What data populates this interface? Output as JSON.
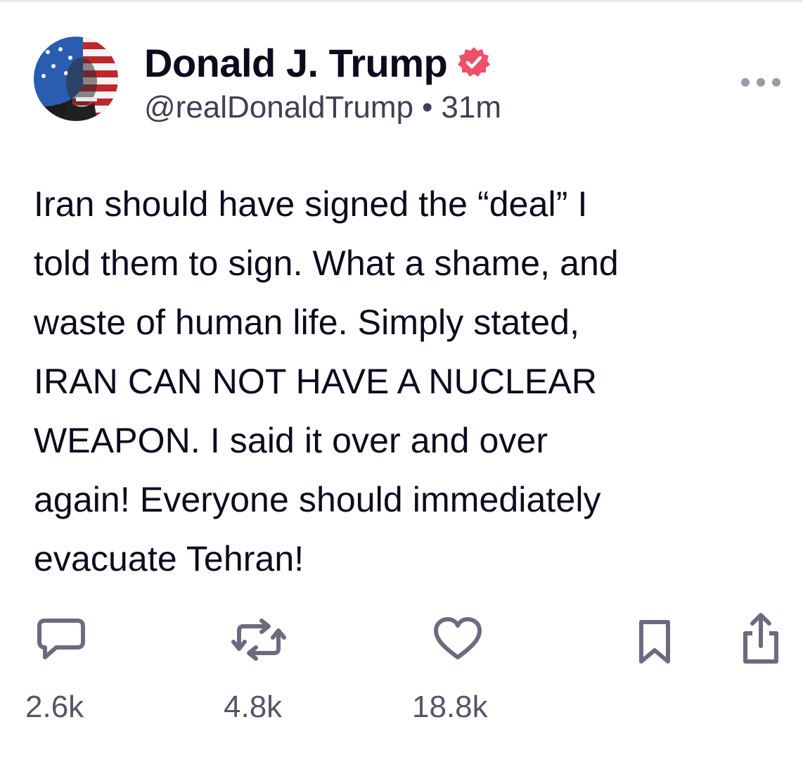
{
  "post": {
    "author": {
      "display_name": "Donald J. Trump",
      "handle": "@realDonaldTrump",
      "verified": true,
      "verified_color": "#ef4f68"
    },
    "separator": "•",
    "time_ago": "31m",
    "text": "Iran should have signed the “deal” I\ntold them to sign. What a shame, and\nwaste of human life. Simply stated,\nIRAN CAN NOT HAVE A NUCLEAR\nWEAPON. I said it over and over\nagain! Everyone should immediately\nevacuate Tehran!"
  },
  "actions": {
    "reply": {
      "icon": "reply-icon",
      "count": "2.6k"
    },
    "repost": {
      "icon": "repost-icon",
      "count": "4.8k"
    },
    "like": {
      "icon": "heart-icon",
      "count": "18.8k"
    },
    "bookmark": {
      "icon": "bookmark-icon"
    },
    "share": {
      "icon": "share-icon"
    }
  },
  "colors": {
    "text": "#0b0b1e",
    "muted": "#55556a",
    "icon": "#6b6b80",
    "badge": "#ef4f68"
  }
}
